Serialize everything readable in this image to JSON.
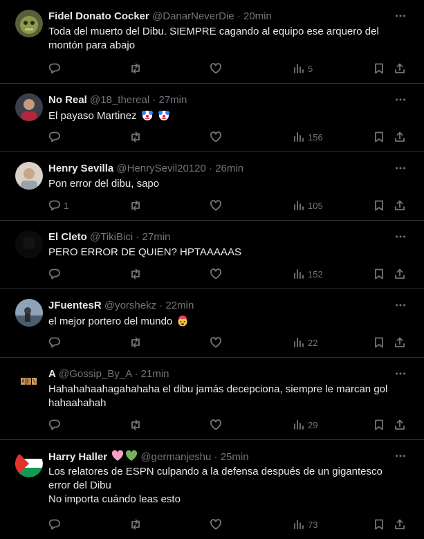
{
  "tweets": [
    {
      "name": "Fidel Donato Cocker",
      "handle": "@DanarNeverDie",
      "time": "20min",
      "lines": [
        "Toda del muerto del Dibu. SIEMPRE cagando al equipo ese arquero del",
        "montón para abajo"
      ],
      "replies": "",
      "views": "5",
      "avatar": "green-creature-avatar"
    },
    {
      "name": "No Real",
      "handle": "@18_thereal",
      "time": "27min",
      "lines": [
        "El payaso Martinez"
      ],
      "emoji": "clown-face-emoji",
      "replies": "",
      "views": "156",
      "avatar": "person-red-jersey-avatar"
    },
    {
      "name": "Henry Sevilla",
      "handle": "@HenrySevil20120",
      "time": "26min",
      "lines": [
        "Pon error del dibu, sapo"
      ],
      "replies": "1",
      "views": "105",
      "avatar": "person-light-avatar"
    },
    {
      "name": "El Cleto",
      "handle": "@TikiBici",
      "time": "27min",
      "lines": [
        "PERO ERROR DE QUIEN? HPTAAAAAS"
      ],
      "replies": "",
      "views": "152",
      "avatar": "dark-avatar"
    },
    {
      "name": "JFuentesR",
      "handle": "@yorshekz",
      "time": "22min",
      "lines": [
        "el mejor portero del mundo"
      ],
      "emoji": "exploding-head-emoji",
      "replies": "",
      "views": "22",
      "avatar": "beach-person-avatar"
    },
    {
      "name": "A",
      "handle": "@Gossip_By_A",
      "time": "21min",
      "lines": [
        "Hahahahaahagahahaha el dibu jamás decepciona, siempre le marcan gol",
        "hahaahahah"
      ],
      "replies": "",
      "views": "29",
      "avatar": "letter-blocks-avatar"
    },
    {
      "name": "Harry Haller",
      "handle": "@germanjeshu",
      "time": "25min",
      "lines": [
        "Los relatores de ESPN culpando a la defensa después de un gigantesco",
        "error del Dibu",
        "No importa cuándo leas esto"
      ],
      "replies": "",
      "views": "73",
      "avatar": "palestine-flag-avatar"
    }
  ],
  "separator": "·",
  "colors": {
    "background": "#000000",
    "text": "#e7e9ea",
    "secondary": "#71767b",
    "border": "#2f3336"
  }
}
